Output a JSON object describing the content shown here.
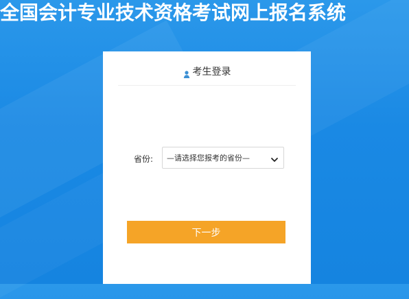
{
  "header": {
    "title": "全国会计专业技术资格考试网上报名系统"
  },
  "login": {
    "icon": "user-icon",
    "title": "考生登录"
  },
  "form": {
    "province_label": "省份:",
    "province_selected": "—请选择您报考的省份—"
  },
  "actions": {
    "next_label": "下一步"
  },
  "colors": {
    "background": "#1a89e4",
    "primary_button": "#f5a427",
    "user_icon": "#3b8fd3"
  }
}
